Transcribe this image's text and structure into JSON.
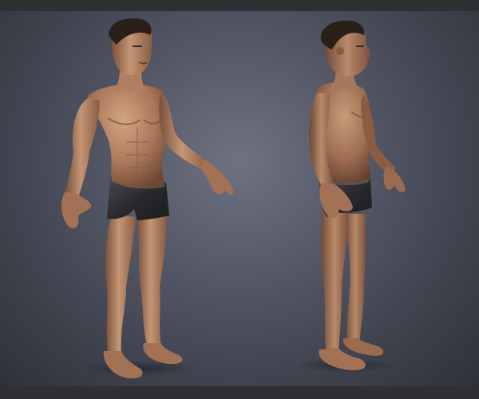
{
  "scene": {
    "subject": "",
    "views": [
      "three-quarter-front",
      "side-profile"
    ],
    "colors": {
      "background_top": "#6f7280",
      "background_bottom": "#2f313a",
      "frame_bar": "#2f3033",
      "skin_light": "#c79a78",
      "skin_mid": "#a9775a",
      "skin_shadow": "#6e4935",
      "hair": "#2a2019",
      "shorts": "#2a2a2e",
      "shorts_highlight": "#4a4a52"
    }
  }
}
